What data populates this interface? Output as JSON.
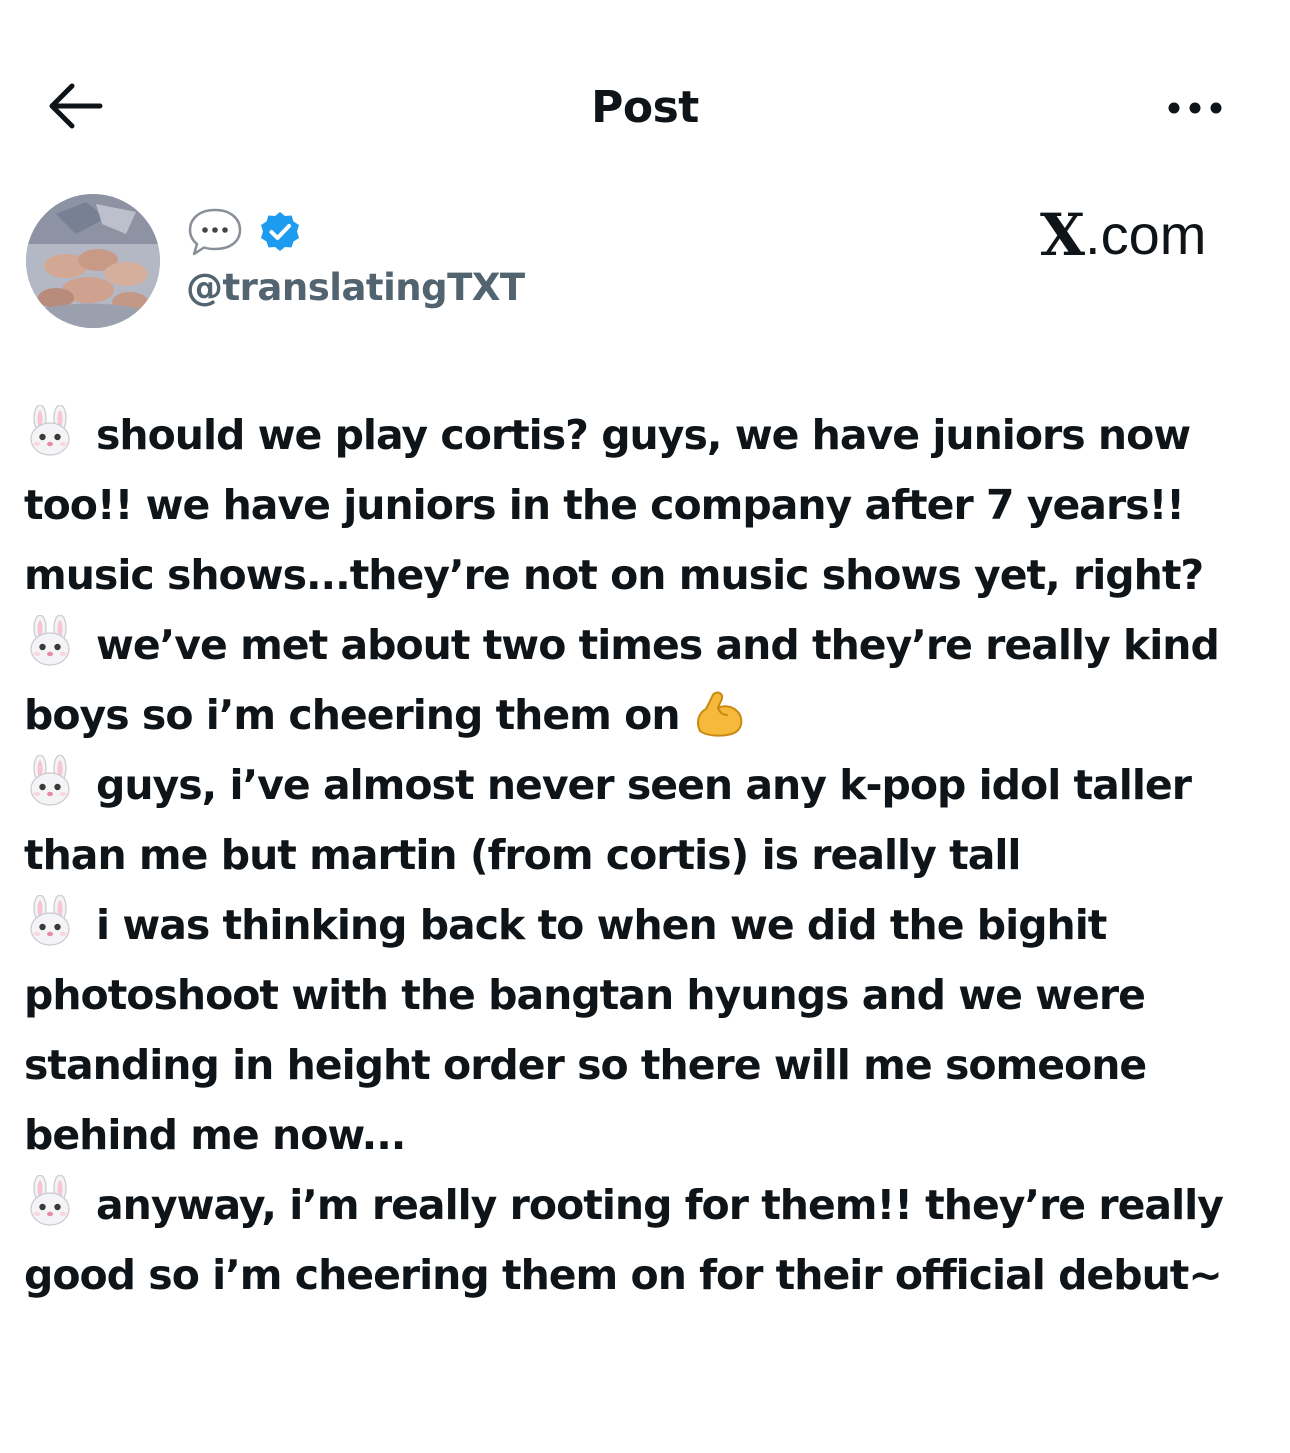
{
  "header": {
    "title": "Post",
    "back_icon": "arrow-left-icon",
    "more_icon": "more-horizontal-icon"
  },
  "author": {
    "name_icon": "speech-bubble-icon",
    "verified_icon": "verified-badge-icon",
    "handle": "@translatingTXT",
    "site_label": ".com",
    "site_mark": "X"
  },
  "post": {
    "paragraphs": [
      {
        "emoji": "rabbit-face-icon",
        "text": "should we play cortis? guys, we have juniors now too!! we have juniors in the company after 7 years!! music shows...they’re not on music shows yet, right?"
      },
      {
        "emoji": "rabbit-face-icon",
        "text": "we’ve met about two times and they’re really kind boys so i’m cheering them on",
        "trailing_emoji": "flexed-biceps-icon"
      },
      {
        "emoji": "rabbit-face-icon",
        "text": "guys, i’ve almost never seen any k-pop idol taller than me but martin (from cortis) is really tall"
      },
      {
        "emoji": "rabbit-face-icon",
        "text": "i was thinking back to when we did the bighit photoshoot with the bangtan hyungs and we were standing in height order so there will me someone behind me now..."
      },
      {
        "emoji": "rabbit-face-icon",
        "text": "anyway, i’m really rooting for them!! they’re really good so i’m cheering them on for their official debut~"
      }
    ]
  },
  "colors": {
    "text": "#0f1419",
    "secondary_text": "#536471",
    "verified_blue": "#1d9bf0"
  }
}
